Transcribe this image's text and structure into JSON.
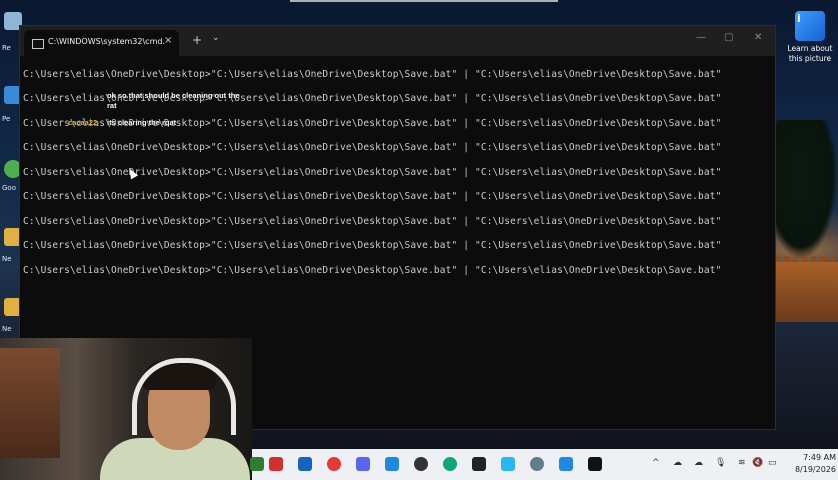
{
  "window": {
    "tab_title": "C:\\WINDOWS\\system32\\cmd.",
    "tab_close": "×",
    "new_tab": "+",
    "tab_dropdown": "⌄",
    "minimize": "—",
    "maximize": "▢",
    "close": "✕"
  },
  "terminal": {
    "lines": [
      "C:\\Users\\elias\\OneDrive\\Desktop>\"C:\\Users\\elias\\OneDrive\\Desktop\\Save.bat\" | \"C:\\Users\\elias\\OneDrive\\Desktop\\Save.bat\"",
      "C:\\Users\\elias\\OneDrive\\Desktop>\"C:\\Users\\elias\\OneDrive\\Desktop\\Save.bat\" | \"C:\\Users\\elias\\OneDrive\\Desktop\\Save.bat\"",
      "C:\\Users\\elias\\OneDrive\\Desktop>\"C:\\Users\\elias\\OneDrive\\Desktop\\Save.bat\" | \"C:\\Users\\elias\\OneDrive\\Desktop\\Save.bat\"",
      "C:\\Users\\elias\\OneDrive\\Desktop>\"C:\\Users\\elias\\OneDrive\\Desktop\\Save.bat\" | \"C:\\Users\\elias\\OneDrive\\Desktop\\Save.bat\"",
      "C:\\Users\\elias\\OneDrive\\Desktop>\"C:\\Users\\elias\\OneDrive\\Desktop\\Save.bat\" | \"C:\\Users\\elias\\OneDrive\\Desktop\\Save.bat\"",
      "C:\\Users\\elias\\OneDrive\\Desktop>\"C:\\Users\\elias\\OneDrive\\Desktop\\Save.bat\" | \"C:\\Users\\elias\\OneDrive\\Desktop\\Save.bat\"",
      "C:\\Users\\elias\\OneDrive\\Desktop>\"C:\\Users\\elias\\OneDrive\\Desktop\\Save.bat\" | \"C:\\Users\\elias\\OneDrive\\Desktop\\Save.bat\"",
      "C:\\Users\\elias\\OneDrive\\Desktop>\"C:\\Users\\elias\\OneDrive\\Desktop\\Save.bat\" | \"C:\\Users\\elias\\OneDrive\\Desktop\\Save.bat\"",
      "C:\\Users\\elias\\OneDrive\\Desktop>\"C:\\Users\\elias\\OneDrive\\Desktop\\Save.bat\" | \"C:\\Users\\elias\\OneDrive\\Desktop\\Save.bat\""
    ]
  },
  "chat_overlay": {
    "message1_text": "ok so that should be cleaning out the",
    "message1_cont": "rat",
    "message2_user": "cacaa22",
    "message2_text": "its clearing the rqat"
  },
  "desktop": {
    "icons": [
      {
        "label": "Re",
        "icon": "recycle-bin-icon",
        "color": "#8fb4d8"
      },
      {
        "label": "Pe",
        "icon": "app-icon",
        "color": "#3a8ad8"
      },
      {
        "label": "Goo",
        "icon": "google-chrome-icon",
        "color": "#4caf50"
      },
      {
        "label": "Ne",
        "icon": "folder-icon",
        "color": "#e0b040"
      },
      {
        "label": "Ne",
        "icon": "folder-icon",
        "color": "#e0b040"
      }
    ],
    "learn_about_picture": "Learn about this picture"
  },
  "taskbar": {
    "apps": [
      {
        "name": "app-icon",
        "color": "#2e7d32"
      },
      {
        "name": "lexis-l-icon",
        "color": "#d32f2f"
      },
      {
        "name": "store-icon",
        "color": "#1565c0"
      },
      {
        "name": "acrobat-icon",
        "color": "#e53935"
      },
      {
        "name": "discord-icon",
        "color": "#5865f2"
      },
      {
        "name": "outlook-icon",
        "color": "#1e88e5"
      },
      {
        "name": "dev-app-icon",
        "color": "#333333"
      },
      {
        "name": "edge-icon",
        "color": "#0fa67a"
      },
      {
        "name": "terminal-app-icon",
        "color": "#222222"
      },
      {
        "name": "notepad-icon",
        "color": "#29b6f6"
      },
      {
        "name": "settings-icon",
        "color": "#607d8b"
      },
      {
        "name": "defender-icon",
        "color": "#1e88e5"
      },
      {
        "name": "cmd-icon",
        "color": "#111111"
      }
    ],
    "tray": {
      "chevron": "^",
      "time": "7:49 AM",
      "date": "8/19/2026"
    }
  }
}
